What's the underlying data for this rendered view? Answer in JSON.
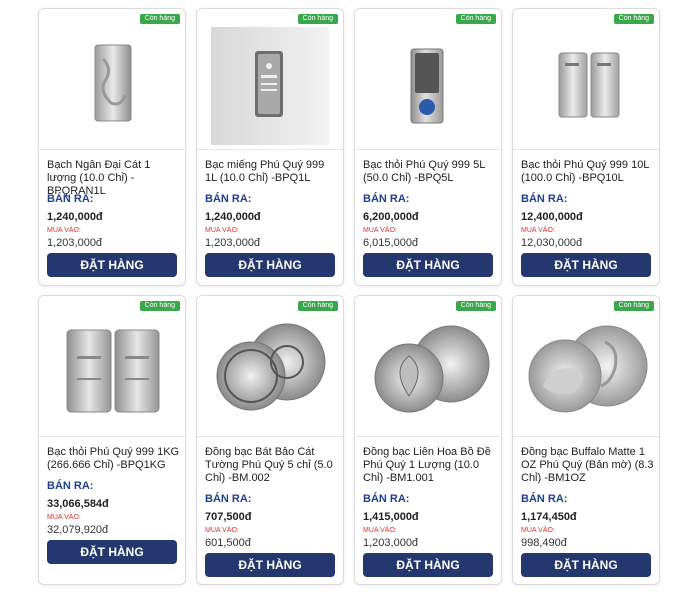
{
  "colors": {
    "badge": "#3aa84a",
    "sell_label": "#1f3f8f",
    "buy_label": "#d33333",
    "button": "#24376e"
  },
  "labels": {
    "sell": "BÁN RA:",
    "buy": "MUA VÀO:",
    "order": "ĐẶT HÀNG",
    "stock": "Còn hàng"
  },
  "products": [
    {
      "title": "Bạch Ngân Đại Cát 1 lượng (10.0 Chỉ) -BPQRAN1L",
      "sell": "1,240,000đ",
      "buy": "1,203,000đ",
      "icon": "silver-bar-dragon-icon"
    },
    {
      "title": "Bạc miếng Phú Quý 999 1L (10.0 Chỉ) -BPQ1L",
      "sell": "1,240,000đ",
      "buy": "1,203,000đ",
      "icon": "silver-bar-packaged-icon"
    },
    {
      "title": "Bạc thỏi Phú Quý 999 5L (50.0 Chỉ) -BPQ5L",
      "sell": "6,200,000đ",
      "buy": "6,015,000đ",
      "icon": "silver-bar-icon"
    },
    {
      "title": "Bạc thỏi Phú Quý 999 10L (100.0 Chỉ) -BPQ10L",
      "sell": "12,400,000đ",
      "buy": "12,030,000đ",
      "icon": "silver-bars-pair-icon"
    },
    {
      "title": "Bạc thỏi Phú Quý 999 1KG (266.666 Chỉ) -BPQ1KG",
      "sell": "33,066,584đ",
      "buy": "32,079,920đ",
      "icon": "silver-kg-bars-icon"
    },
    {
      "title": "Đồng bạc Bát Bảo Cát Tường Phú Quý 5 chỉ (5.0 Chỉ) -BM.002",
      "sell": "707,500đ",
      "buy": "601,500đ",
      "icon": "silver-coin-pair-icon"
    },
    {
      "title": "Đồng bạc Liên Hoa Bồ Đề Phú Quý 1 Lượng (10.0 Chỉ) -BM1.001",
      "sell": "1,415,000đ",
      "buy": "1,203,000đ",
      "icon": "silver-coin-leaf-icon"
    },
    {
      "title": "Đồng bạc Buffalo Matte 1 OZ Phú Quý (Bản mờ) (8.3 Chỉ) -BM1OZ",
      "sell": "1,174,450đ",
      "buy": "998,490đ",
      "icon": "silver-coin-buffalo-icon"
    }
  ]
}
